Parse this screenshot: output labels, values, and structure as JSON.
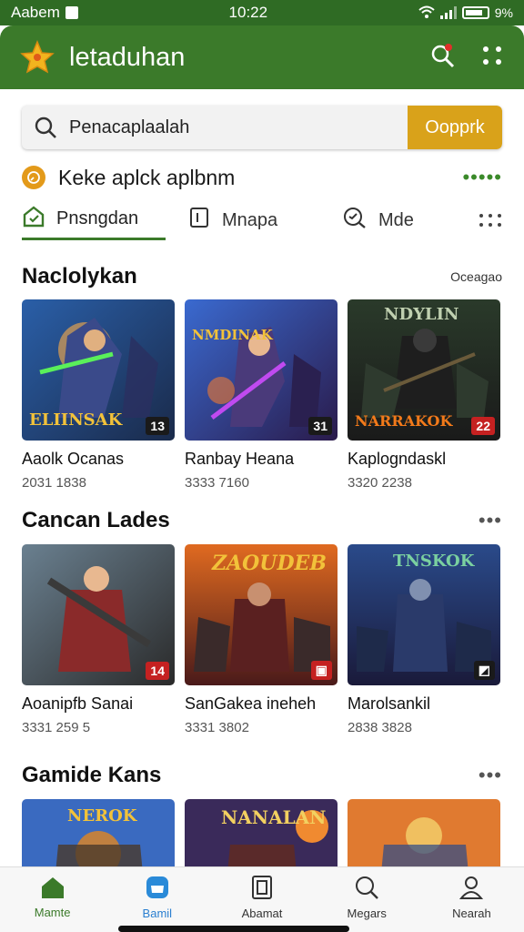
{
  "status": {
    "carrier": "Aabem",
    "time": "10:22",
    "battery": "9%"
  },
  "appbar": {
    "title": "letaduhan",
    "logo_icon": "star-logo-icon",
    "notif_icon": "search-notification-icon",
    "menu_icon": "grid-menu-icon",
    "color": "#3b7a2a"
  },
  "search": {
    "placeholder": "Penacaplaalah",
    "button": "Oopprk",
    "button_color": "#d9a21a"
  },
  "promo": {
    "text": "Keke aplck aplbnm"
  },
  "tabs": [
    {
      "label": "Pnsngdan",
      "icon": "house-tag-icon"
    },
    {
      "label": "Mnapa",
      "icon": "bookmark-icon"
    },
    {
      "label": "Mde",
      "icon": "search-chat-icon"
    }
  ],
  "sections": [
    {
      "title": "Naclolykan",
      "more": "Oceagao",
      "items": [
        {
          "name": "Aaolk Ocanas",
          "meta": "2031 1838",
          "badge": "13",
          "cover_text": "ELIINSAK"
        },
        {
          "name": "Ranbay Heana",
          "meta": "3333 7160",
          "badge": "31",
          "cover_text": "NMDINAK"
        },
        {
          "name": "Kaplogndaskl",
          "meta": "3320 2238",
          "badge": "22",
          "cover_text": "NARRAKOK"
        }
      ]
    },
    {
      "title": "Cancan Lades",
      "more": "",
      "items": [
        {
          "name": "Aoanipfb Sanai",
          "meta": "3331 259 5",
          "badge": "14",
          "cover_text": ""
        },
        {
          "name": "SanGakea ineheh",
          "meta": "3331 3802",
          "badge": "",
          "cover_text": "ZAOUDEB"
        },
        {
          "name": "Marolsankil",
          "meta": "2838 3828",
          "badge": "",
          "cover_text": "TNSKOK"
        }
      ]
    },
    {
      "title": "Gamide Kans",
      "more": "",
      "items": [
        {
          "name": "",
          "meta": "",
          "badge": "",
          "cover_text": "NEROK"
        },
        {
          "name": "",
          "meta": "",
          "badge": "",
          "cover_text": "NANALAN"
        },
        {
          "name": "",
          "meta": "",
          "badge": "",
          "cover_text": ""
        }
      ]
    }
  ],
  "nav": [
    {
      "label": "Mamte",
      "icon": "home-icon"
    },
    {
      "label": "Bamil",
      "icon": "store-icon"
    },
    {
      "label": "Abamat",
      "icon": "document-icon"
    },
    {
      "label": "Megars",
      "icon": "search-icon"
    },
    {
      "label": "Nearah",
      "icon": "profile-icon"
    }
  ]
}
